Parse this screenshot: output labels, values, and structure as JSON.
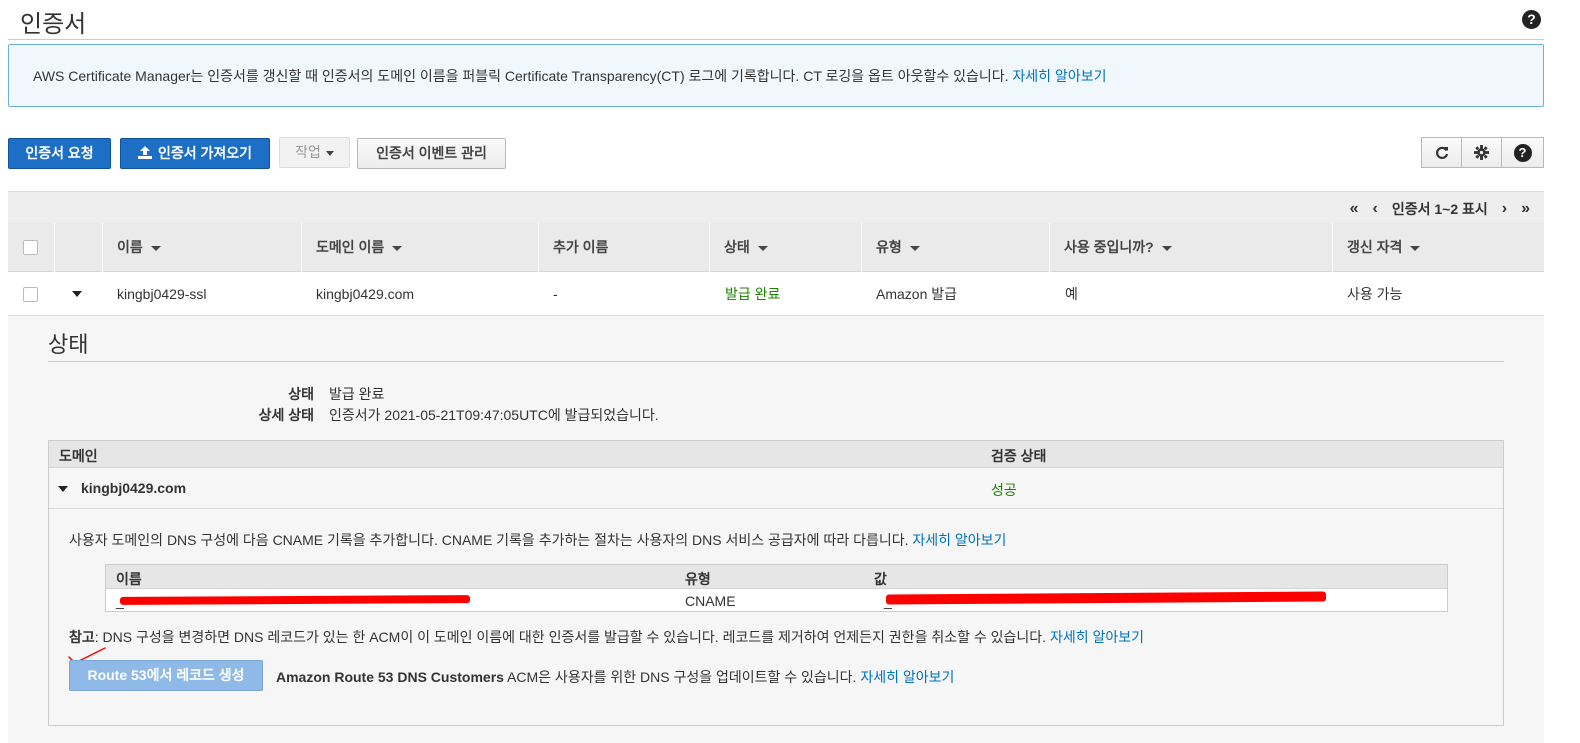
{
  "page": {
    "title": "인증서"
  },
  "info_banner": {
    "text": "AWS Certificate Manager는 인증서를 갱신할 때 인증서의 도메인 이름을 퍼블릭 Certificate Transparency(CT) 로그에 기록합니다. CT 로깅을 옵트 아웃할수 있습니다.",
    "link": "자세히 알아보기"
  },
  "toolbar": {
    "request_label": "인증서 요청",
    "import_label": "인증서 가져오기",
    "actions_label": "작업",
    "events_label": "인증서 이벤트 관리",
    "icons": [
      "refresh-icon",
      "gear-icon",
      "help-icon"
    ]
  },
  "pager": {
    "first": "«",
    "prev": "‹",
    "label": "인증서 1~2 표시",
    "next": "›",
    "last": "»"
  },
  "table": {
    "columns": [
      "이름",
      "도메인 이름",
      "추가 이름",
      "상태",
      "유형",
      "사용 중입니까?",
      "갱신 자격"
    ],
    "rows": [
      {
        "name": "kingbj0429-ssl",
        "domain": "kingbj0429.com",
        "additional": "-",
        "status": "발급 완료",
        "type": "Amazon 발급",
        "in_use": "예",
        "renewal": "사용 가능"
      }
    ]
  },
  "detail": {
    "title": "상태",
    "status_key": "상태",
    "status_value": "발급 완료",
    "detail_status_key": "상세 상태",
    "detail_status_value": "인증서가 2021-05-21T09:47:05UTC에 발급되었습니다.",
    "domain_table": {
      "col_domain": "도메인",
      "col_validation": "검증 상태",
      "domain": "kingbj0429.com",
      "validation": "성공",
      "instructions": "사용자 도메인의 DNS 구성에 다음 CNAME 기록을 추가합니다. CNAME 기록을 추가하는 절차는 사용자의 DNS 서비스 공급자에 따라 다릅니다.",
      "instructions_link": "자세히 알아보기",
      "cname": {
        "col_name": "이름",
        "col_type": "유형",
        "col_value": "값",
        "name_prefix": "_",
        "type": "CNAME",
        "value_prefix": "_"
      },
      "note_label": "참고",
      "note_text": ": DNS 구성을 변경하면 DNS 레코드가 있는 한 ACM이 이 도메인 이름에 대한 인증서를 발급할 수 있습니다. 레코드를 제거하여 언제든지 권한을 취소할 수 있습니다.",
      "note_link": "자세히 알아보기",
      "route53_button": "Route 53에서 레코드 생성",
      "route53_bold": "Amazon Route 53 DNS Customers",
      "route53_text": " ACM은 사용자를 위한 DNS 구성을 업데이트할 수 있습니다.",
      "route53_link": "자세히 알아보기"
    }
  },
  "colors": {
    "primary": "#1c6fc4",
    "success": "#1d8102",
    "link": "#0073bb",
    "redaction": "#ff0000"
  }
}
